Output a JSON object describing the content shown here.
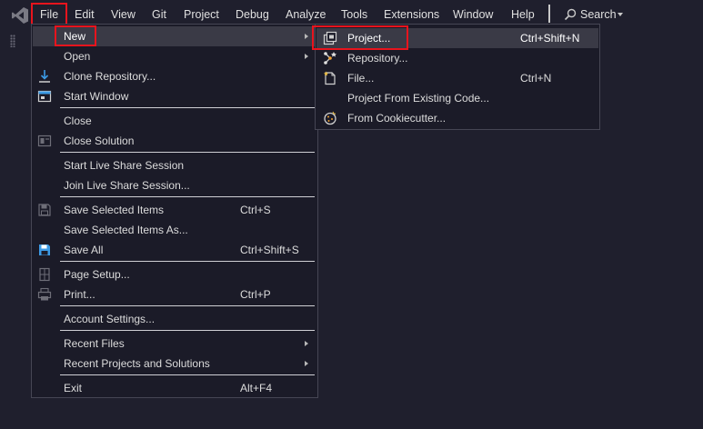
{
  "menubar": {
    "items": [
      "File",
      "Edit",
      "View",
      "Git",
      "Project",
      "Debug",
      "Analyze",
      "Tools",
      "Extensions",
      "Window",
      "Help"
    ],
    "search_label": "Search"
  },
  "file_menu": {
    "new": "New",
    "open": "Open",
    "clone": "Clone Repository...",
    "start_window": "Start Window",
    "close": "Close",
    "close_solution": "Close Solution",
    "start_live_share": "Start Live Share Session",
    "join_live_share": "Join Live Share Session...",
    "save_selected": "Save Selected Items",
    "save_selected_sc": "Ctrl+S",
    "save_selected_as": "Save Selected Items As...",
    "save_all": "Save All",
    "save_all_sc": "Ctrl+Shift+S",
    "page_setup": "Page Setup...",
    "print": "Print...",
    "print_sc": "Ctrl+P",
    "account_settings": "Account Settings...",
    "recent_files": "Recent Files",
    "recent_projects": "Recent Projects and Solutions",
    "exit": "Exit",
    "exit_sc": "Alt+F4"
  },
  "new_submenu": {
    "project": "Project...",
    "project_sc": "Ctrl+Shift+N",
    "repository": "Repository...",
    "file": "File...",
    "file_sc": "Ctrl+N",
    "from_existing": "Project From Existing Code...",
    "cookiecutter": "From Cookiecutter..."
  },
  "icons": {
    "app_logo": "visual-studio-logo-icon",
    "search": "search-icon",
    "clone": "download-arrow-icon",
    "start_window": "start-window-icon",
    "close_solution": "close-solution-icon",
    "save_selected": "save-icon",
    "save_all": "save-all-icon",
    "page_setup": "page-setup-icon",
    "print": "printer-icon",
    "project": "new-project-icon",
    "repository": "new-repository-icon",
    "file": "new-file-icon",
    "cookiecutter": "cookiecutter-icon"
  },
  "colors": {
    "background": "#1f1f2d",
    "menu_background": "#1b1b28",
    "highlight_row": "#3a3a46",
    "annotation_box": "#e8141d",
    "accent_blue": "#3c9be6"
  }
}
